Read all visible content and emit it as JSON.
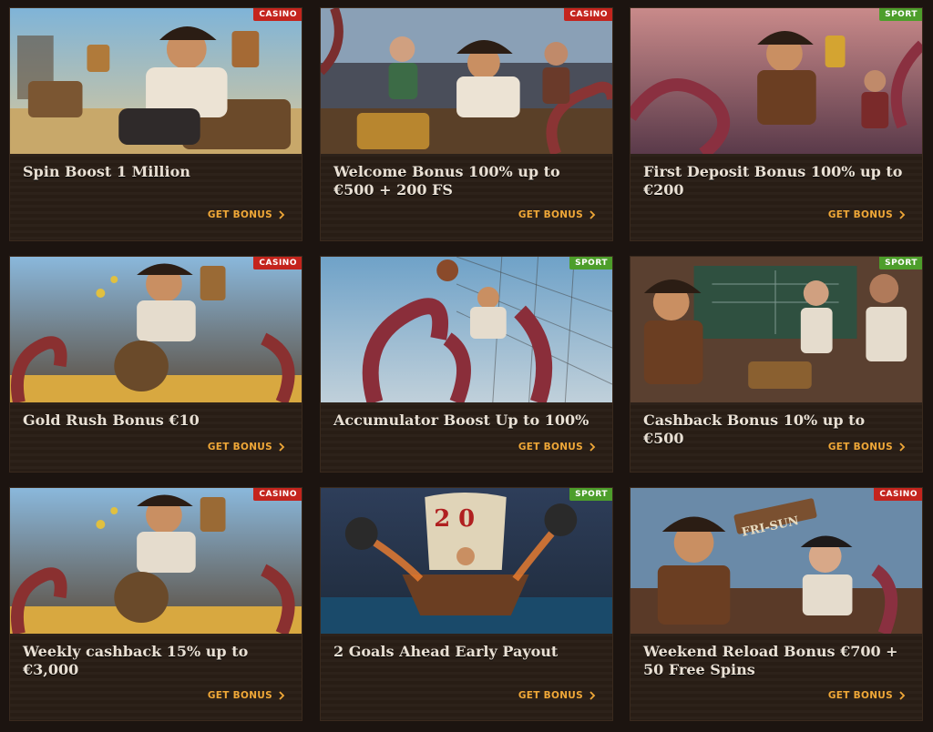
{
  "promotions": [
    {
      "title": "Spin Boost 1 Million",
      "badge": "CASINO",
      "cta": "GET BONUS",
      "scene": "pirate-treasure-beach"
    },
    {
      "title": "Welcome Bonus 100% up to €500 + 200 FS",
      "badge": "CASINO",
      "cta": "GET BONUS",
      "scene": "pirate-crew-treasure-octopus"
    },
    {
      "title": "First Deposit Bonus 100% up to €200",
      "badge": "SPORT",
      "cta": "GET BONUS",
      "scene": "pirate-trophy-octopus"
    },
    {
      "title": "Gold Rush Bonus €10",
      "badge": "CASINO",
      "cta": "GET BONUS",
      "scene": "pirate-barrel-gold"
    },
    {
      "title": "Accumulator Boost Up to 100%",
      "badge": "SPORT",
      "cta": "GET BONUS",
      "scene": "octopus-goalkeeper"
    },
    {
      "title": "Cashback Bonus 10% up to €500",
      "badge": "SPORT",
      "cta": "GET BONUS",
      "scene": "pirates-tactics-board"
    },
    {
      "title": "Weekly cashback 15% up to €3,000",
      "badge": "CASINO",
      "cta": "GET BONUS",
      "scene": "pirate-barrel-gold"
    },
    {
      "title": "2 Goals Ahead Early Payout",
      "badge": "SPORT",
      "cta": "GET BONUS",
      "scene": "pirate-ship-cannons"
    },
    {
      "title": "Weekend Reload Bonus €700 + 50 Free Spins",
      "badge": "CASINO",
      "cta": "GET BONUS",
      "scene": "pirates-fri-sun"
    }
  ],
  "scene_signs": {
    "pirates-fri-sun": "FRI-SUN",
    "pirate-ship-cannons": "2 0"
  },
  "colors": {
    "casino_badge": "#c4241d",
    "sport_badge": "#4d9e2b",
    "cta": "#f0a838"
  }
}
